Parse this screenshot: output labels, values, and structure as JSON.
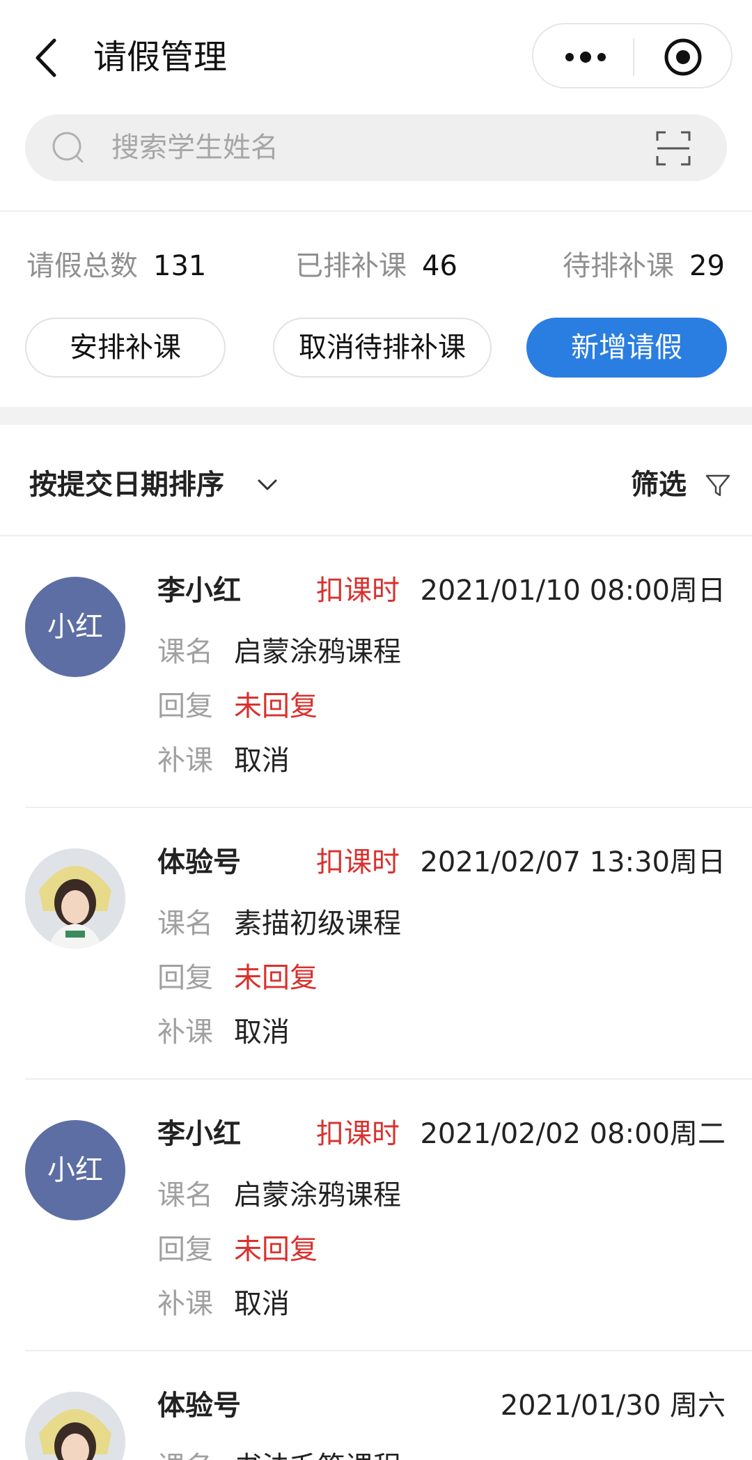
{
  "header": {
    "title": "请假管理"
  },
  "search": {
    "placeholder": "搜索学生姓名"
  },
  "stats": [
    {
      "label": "请假总数",
      "value": "131"
    },
    {
      "label": "已排补课",
      "value": "46"
    },
    {
      "label": "待排补课",
      "value": "29"
    }
  ],
  "actions": {
    "arrange": "安排补课",
    "cancel_pending": "取消待排补课",
    "add_leave": "新增请假"
  },
  "sort": {
    "label": "按提交日期排序",
    "filter": "筛选"
  },
  "labels": {
    "course": "课名",
    "reply": "回复",
    "makeup": "补课"
  },
  "records": [
    {
      "name": "李小红",
      "avatar_text": "小红",
      "deduct": "扣课时",
      "date": "2021/01/10 08:00周日",
      "course": "启蒙涂鸦课程",
      "reply": "未回复",
      "makeup": "取消"
    },
    {
      "name": "体验号",
      "avatar_text": "",
      "deduct": "扣课时",
      "date": "2021/02/07 13:30周日",
      "course": "素描初级课程",
      "reply": "未回复",
      "makeup": "取消"
    },
    {
      "name": "李小红",
      "avatar_text": "小红",
      "deduct": "扣课时",
      "date": "2021/02/02 08:00周二",
      "course": "启蒙涂鸦课程",
      "reply": "未回复",
      "makeup": "取消"
    },
    {
      "name": "体验号",
      "avatar_text": "",
      "deduct": "",
      "date": "2021/01/30 周六",
      "course": "书法毛笔课程"
    }
  ],
  "colors": {
    "primary": "#2a7de1",
    "alert": "#d9312d",
    "avatar": "#5c6ea3"
  }
}
